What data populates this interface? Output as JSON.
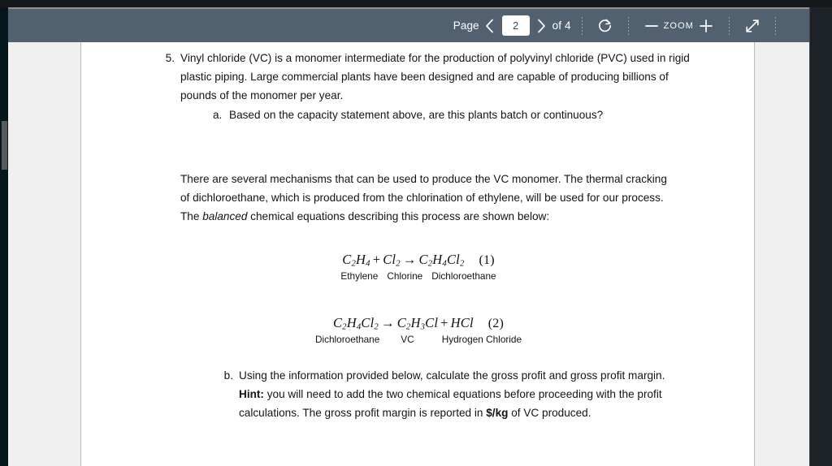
{
  "viewer": {
    "toolbar": {
      "page_label": "Page",
      "prev_icon": "chevron-left-icon",
      "page_value": "2",
      "next_icon": "chevron-right-icon",
      "of_label": "of 4",
      "rotate_icon": "rotate-icon",
      "zoom_out_icon": "minus-icon",
      "zoom_label": "ZOOM",
      "zoom_in_icon": "plus-icon",
      "fullscreen_icon": "expand-diagonal-icon"
    }
  },
  "document": {
    "question": {
      "number": "5.",
      "text": "Vinyl chloride (VC) is a monomer intermediate for the production of polyvinyl chloride (PVC) used in rigid plastic piping.  Large commercial plants have been designed and are capable of producing billions of pounds of the monomer per year.",
      "sub_a": {
        "letter": "a.",
        "text": "Based on the capacity statement above, are this plants batch or continuous?"
      }
    },
    "paragraph2": {
      "part1": "There are several mechanisms that can be used to produce the VC monomer.  The thermal cracking of dichloroethane, which is produced from the chlorination of ethylene, will be used for our process.  The ",
      "emphasis": "balanced",
      "part2": " chemical equations describing this process are shown below:"
    },
    "equations": [
      {
        "id": "equation-1",
        "tag": "(1)",
        "reactant1": "C2H4",
        "operator1": "+",
        "reactant2": "Cl2",
        "arrow": "→",
        "product1": "C2H4Cl2",
        "names": [
          "Ethylene",
          "Chlorine",
          "Dichloroethane"
        ]
      },
      {
        "id": "equation-2",
        "tag": "(2)",
        "reactant1": "C2H4Cl2",
        "arrow": "→",
        "product1": "C2H3Cl",
        "operator1": "+",
        "product2": "HCl",
        "names": [
          "Dichloroethane",
          "VC",
          "Hydrogen Chloride"
        ]
      }
    ],
    "sub_b": {
      "letter": "b.",
      "text_part1": "Using the information provided below, calculate the gross profit and gross profit margin.  ",
      "hint_label": "Hint:",
      "text_part2": "  you will need to add the two chemical equations before proceeding with the profit calculations.  The gross profit margin is reported in ",
      "bold_units": "$/kg",
      "text_part3": " of VC produced."
    }
  },
  "colors": {
    "toolbar_bg": "#52616f",
    "page_bg": "#ffffff",
    "viewport_bg": "#f0f0f0",
    "bezel": "#14181b",
    "text": "#141414"
  }
}
